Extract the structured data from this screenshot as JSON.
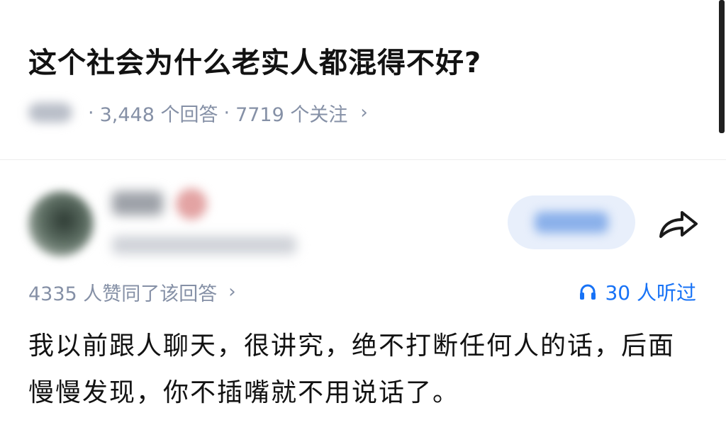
{
  "question": {
    "title": "这个社会为什么老实人都混得不好?",
    "answer_count": "3,448 个回答",
    "separator": "·",
    "follow_count": "7719 个关注",
    "chevron": "›"
  },
  "answer": {
    "upvote_text": "4335 人赞同了该回答",
    "chevron": "›",
    "listen_text": "30 人听过",
    "body": "我以前跟人聊天，很讲究，绝不打断任何人的话，后面慢慢发现，你不插嘴就不用说话了。"
  },
  "colors": {
    "meta_text": "#8590a6",
    "accent_blue": "#1772f6",
    "follow_button_bg": "#e8effb",
    "title_text": "#121212"
  },
  "icons": {
    "share": "share-icon",
    "listen": "headphone-icon"
  }
}
